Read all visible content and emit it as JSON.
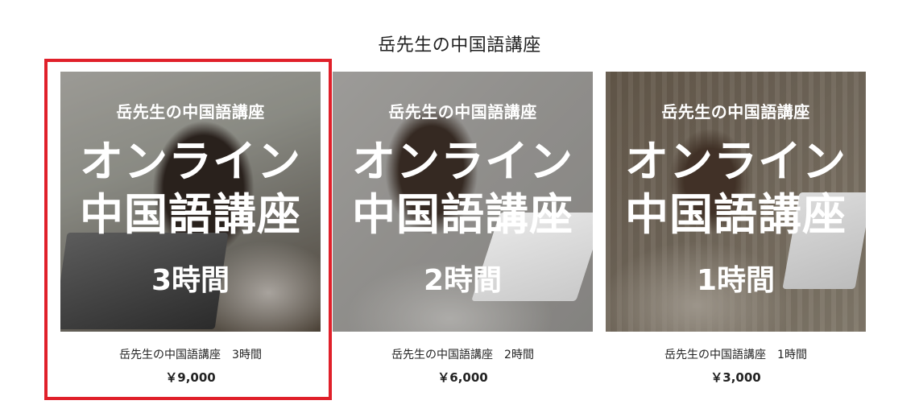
{
  "page": {
    "title": "岳先生の中国語講座"
  },
  "highlight": {
    "color": "#e0202a"
  },
  "products": [
    {
      "thumb": {
        "brand": "岳先生の中国語講座",
        "line1": "オンライン",
        "line2": "中国語講座",
        "hours": "3時間"
      },
      "name": "岳先生の中国語講座　3時間",
      "price": "￥9,000"
    },
    {
      "thumb": {
        "brand": "岳先生の中国語講座",
        "line1": "オンライン",
        "line2": "中国語講座",
        "hours": "2時間"
      },
      "name": "岳先生の中国語講座　2時間",
      "price": "￥6,000"
    },
    {
      "thumb": {
        "brand": "岳先生の中国語講座",
        "line1": "オンライン",
        "line2": "中国語講座",
        "hours": "1時間"
      },
      "name": "岳先生の中国語講座　1時間",
      "price": "￥3,000"
    }
  ]
}
